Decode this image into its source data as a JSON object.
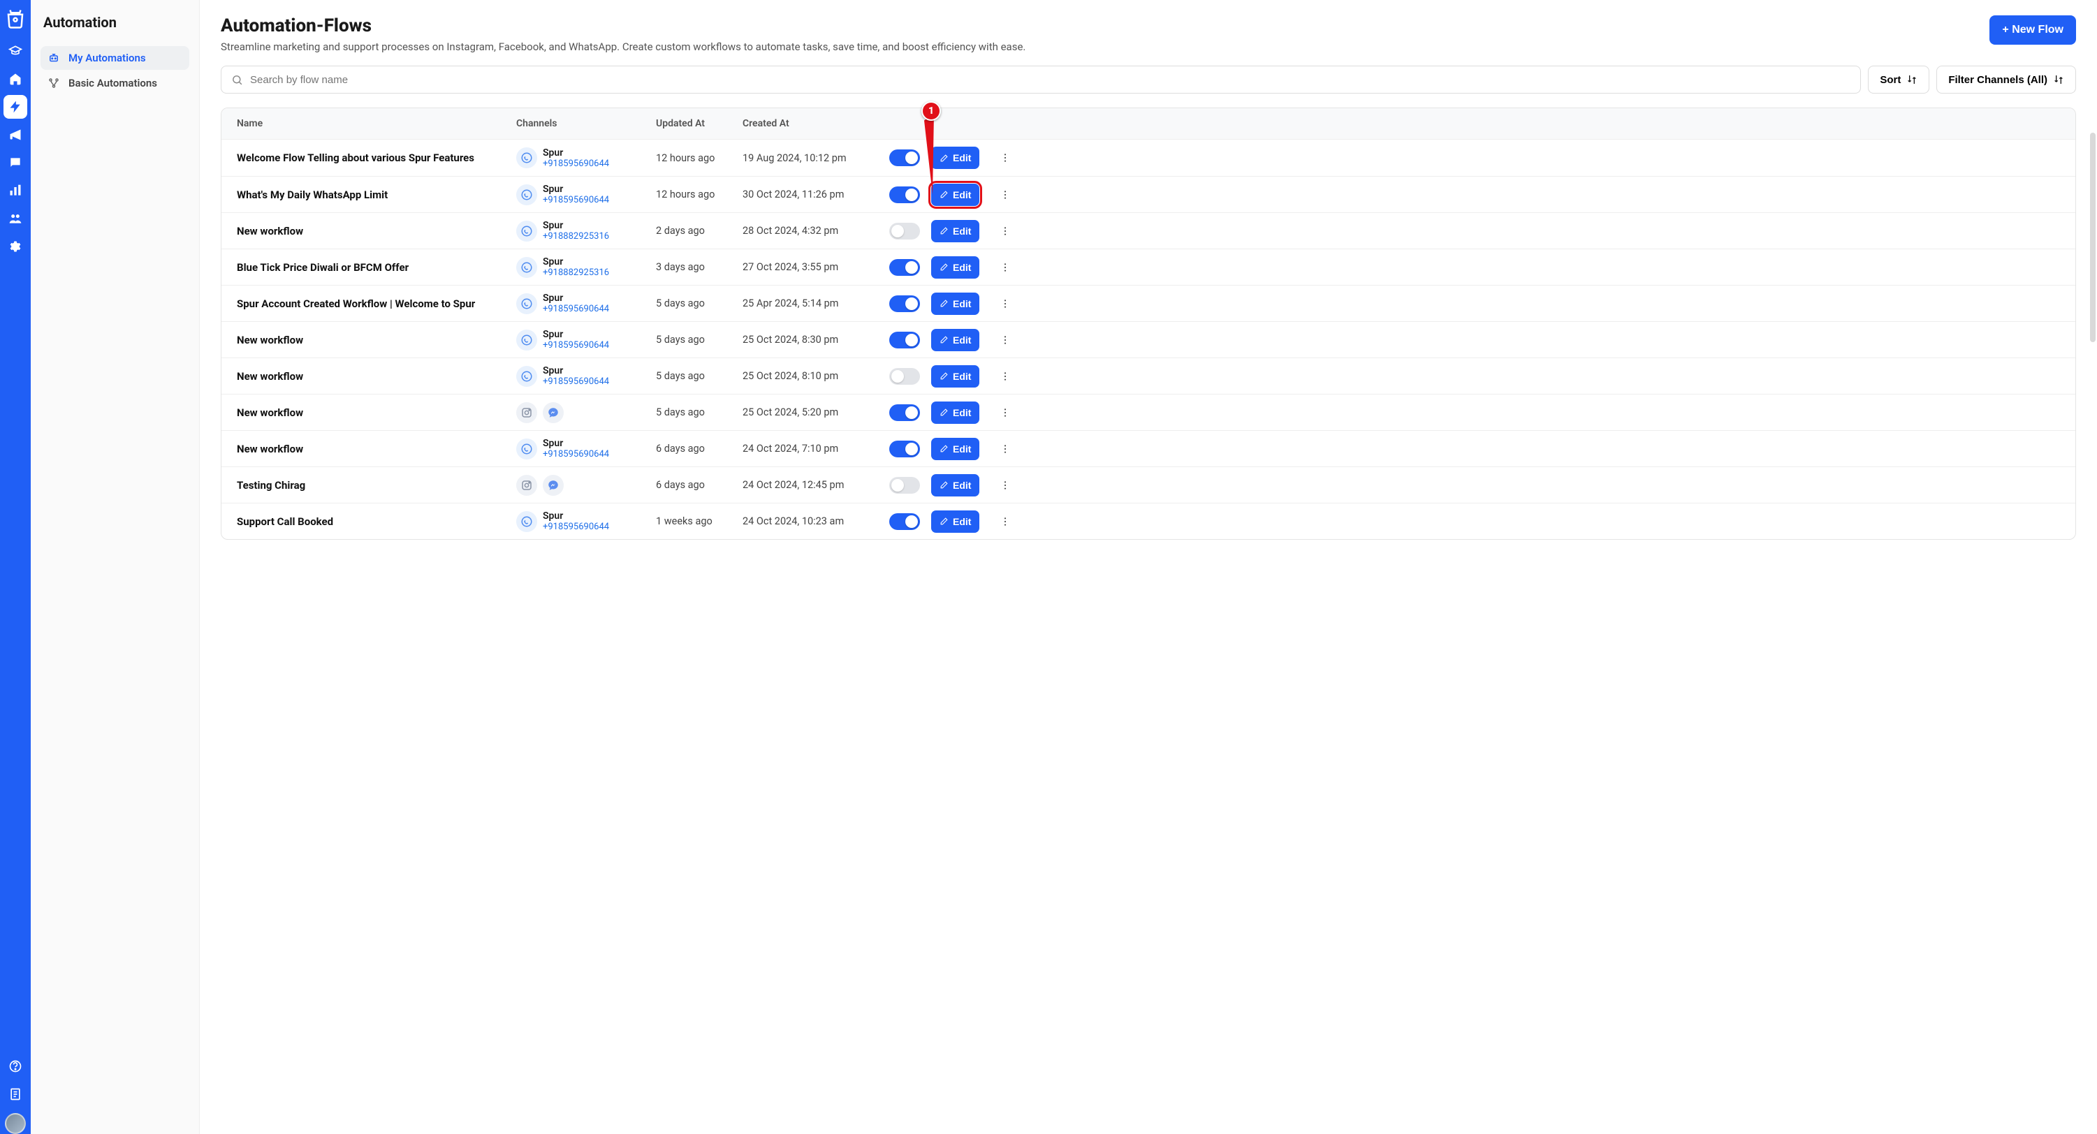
{
  "rail": {
    "items": [
      "shop",
      "academy",
      "home",
      "automation",
      "campaigns",
      "chat",
      "analytics",
      "contacts",
      "settings"
    ],
    "active": 3,
    "bottom": [
      "help",
      "docs"
    ]
  },
  "sidebar": {
    "title": "Automation",
    "items": [
      {
        "label": "My Automations",
        "icon": "bot"
      },
      {
        "label": "Basic Automations",
        "icon": "flow"
      }
    ],
    "active": 0
  },
  "header": {
    "title": "Automation-Flows",
    "subtitle": "Streamline marketing and support processes on Instagram, Facebook, and WhatsApp. Create custom workflows to automate tasks, save time, and boost efficiency with ease.",
    "new_flow_label": "+ New Flow"
  },
  "controls": {
    "search_placeholder": "Search by flow name",
    "sort_label": "Sort",
    "filter_label": "Filter Channels (All)"
  },
  "table": {
    "headers": {
      "name": "Name",
      "channels": "Channels",
      "updated": "Updated At",
      "created": "Created At"
    },
    "edit_label": "Edit",
    "rows": [
      {
        "name": "Welcome Flow Telling about various Spur Features",
        "channels": [
          {
            "type": "wa",
            "label": "Spur",
            "sub": "+918595690644"
          }
        ],
        "updated": "12 hours ago",
        "created": "19 Aug 2024, 10:12 pm",
        "on": true,
        "highlight": false
      },
      {
        "name": "What's My Daily WhatsApp Limit",
        "channels": [
          {
            "type": "wa",
            "label": "Spur",
            "sub": "+918595690644"
          }
        ],
        "updated": "12 hours ago",
        "created": "30 Oct 2024, 11:26 pm",
        "on": true,
        "highlight": true
      },
      {
        "name": "New workflow",
        "channels": [
          {
            "type": "wa",
            "label": "Spur",
            "sub": "+918882925316"
          }
        ],
        "updated": "2 days ago",
        "created": "28 Oct 2024, 4:32 pm",
        "on": false,
        "highlight": false
      },
      {
        "name": "Blue Tick Price Diwali or BFCM Offer",
        "channels": [
          {
            "type": "wa",
            "label": "Spur",
            "sub": "+918882925316"
          }
        ],
        "updated": "3 days ago",
        "created": "27 Oct 2024, 3:55 pm",
        "on": true,
        "highlight": false
      },
      {
        "name": "Spur Account Created Workflow | Welcome to Spur",
        "channels": [
          {
            "type": "wa",
            "label": "Spur",
            "sub": "+918595690644"
          }
        ],
        "updated": "5 days ago",
        "created": "25 Apr 2024, 5:14 pm",
        "on": true,
        "highlight": false
      },
      {
        "name": "New workflow",
        "channels": [
          {
            "type": "wa",
            "label": "Spur",
            "sub": "+918595690644"
          }
        ],
        "updated": "5 days ago",
        "created": "25 Oct 2024, 8:30 pm",
        "on": true,
        "highlight": false
      },
      {
        "name": "New workflow",
        "channels": [
          {
            "type": "wa",
            "label": "Spur",
            "sub": "+918595690644"
          }
        ],
        "updated": "5 days ago",
        "created": "25 Oct 2024, 8:10 pm",
        "on": false,
        "highlight": false
      },
      {
        "name": "New workflow",
        "channels": [
          {
            "type": "ig"
          },
          {
            "type": "msg"
          }
        ],
        "updated": "5 days ago",
        "created": "25 Oct 2024, 5:20 pm",
        "on": true,
        "highlight": false
      },
      {
        "name": "New workflow",
        "channels": [
          {
            "type": "wa",
            "label": "Spur",
            "sub": "+918595690644"
          }
        ],
        "updated": "6 days ago",
        "created": "24 Oct 2024, 7:10 pm",
        "on": true,
        "highlight": false
      },
      {
        "name": "Testing Chirag",
        "channels": [
          {
            "type": "ig"
          },
          {
            "type": "msg"
          }
        ],
        "updated": "6 days ago",
        "created": "24 Oct 2024, 12:45 pm",
        "on": false,
        "highlight": false
      },
      {
        "name": "Support Call Booked",
        "channels": [
          {
            "type": "wa",
            "label": "Spur",
            "sub": "+918595690644"
          }
        ],
        "updated": "1 weeks ago",
        "created": "24 Oct 2024, 10:23 am",
        "on": true,
        "highlight": false
      }
    ]
  },
  "annotation": {
    "number": "1"
  }
}
